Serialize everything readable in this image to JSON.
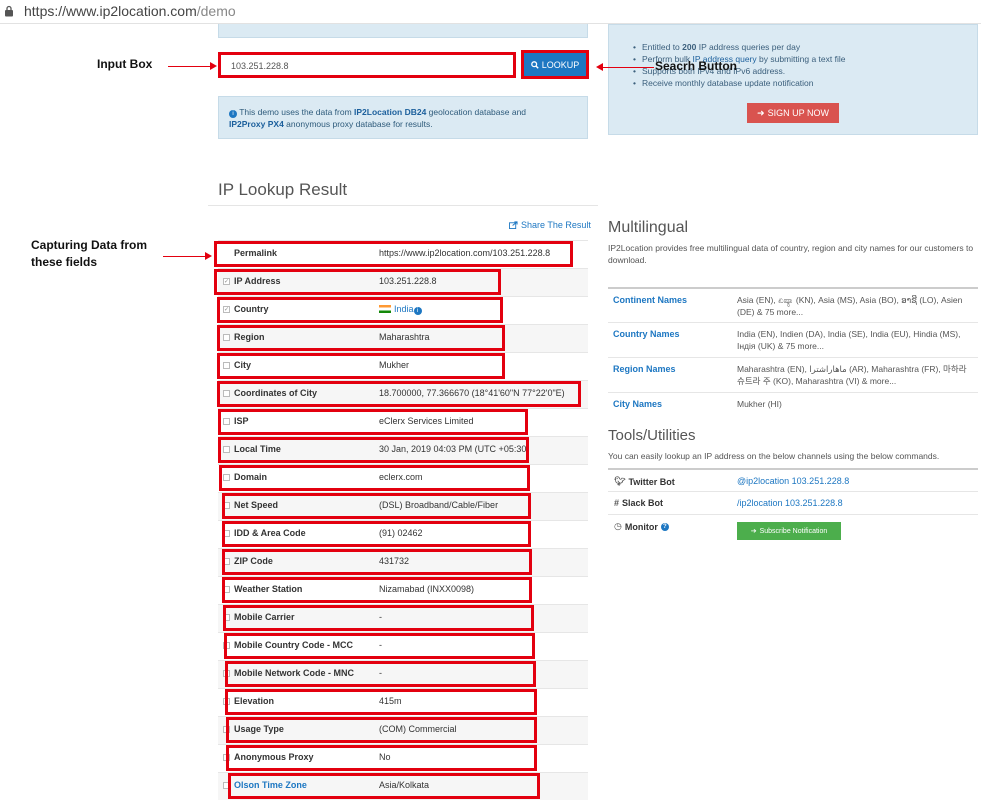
{
  "browser": {
    "url_main": "https://www.ip2location.com",
    "url_path": "/demo"
  },
  "search": {
    "input_value": "103.251.228.8",
    "lookup_label": "LOOKUP"
  },
  "annotations": {
    "input_box": "Input Box",
    "search_button": "Seacrh Button",
    "capturing_line1": "Capturing Data from",
    "capturing_line2": "these fields"
  },
  "info": {
    "prefix": "This demo uses the data from ",
    "db1": "IP2Location DB24",
    "middle": " geolocation database and",
    "db2": "IP2Proxy PX4",
    "suffix": " anonymous proxy database for results."
  },
  "promo": {
    "item1_pre": "Entitled to ",
    "item1_bold": "200",
    "item1_post": " IP address queries per day",
    "item2_pre": "Perform bulk ",
    "item2_link": "IP address query",
    "item2_post": " by submitting a text file",
    "item3": "Supports both IPv4 and IPv6 address.",
    "item4": "Receive monthly database update notification",
    "signup_label": "SIGN UP NOW"
  },
  "result": {
    "title": "IP Lookup Result",
    "share_label": "Share The Result",
    "rows": [
      {
        "label": "Permalink",
        "value": "https://www.ip2location.com/103.251.228.8"
      },
      {
        "label": "IP Address",
        "value": "103.251.228.8"
      },
      {
        "label": "Country",
        "value": "India"
      },
      {
        "label": "Region",
        "value": "Maharashtra"
      },
      {
        "label": "City",
        "value": "Mukher"
      },
      {
        "label": "Coordinates of City",
        "value": "18.700000, 77.366670 (18°41'60\"N   77°22'0\"E)"
      },
      {
        "label": "ISP",
        "value": "eClerx Services Limited"
      },
      {
        "label": "Local Time",
        "value": "30 Jan, 2019 04:03 PM (UTC +05:30)"
      },
      {
        "label": "Domain",
        "value": "eclerx.com"
      },
      {
        "label": "Net Speed",
        "value": "(DSL) Broadband/Cable/Fiber"
      },
      {
        "label": "IDD & Area Code",
        "value": "(91) 02462"
      },
      {
        "label": "ZIP Code",
        "value": "431732"
      },
      {
        "label": "Weather Station",
        "value": "Nizamabad (INXX0098)"
      },
      {
        "label": "Mobile Carrier",
        "value": "-"
      },
      {
        "label": "Mobile Country Code - MCC",
        "value": "-"
      },
      {
        "label": "Mobile Network Code - MNC",
        "value": "-"
      },
      {
        "label": "Elevation",
        "value": "415m"
      },
      {
        "label": "Usage Type",
        "value": "(COM) Commercial"
      },
      {
        "label": "Anonymous Proxy",
        "value": "No"
      },
      {
        "label": "Olson Time Zone",
        "value": "Asia/Kolkata"
      }
    ]
  },
  "multilingual": {
    "title": "Multilingual",
    "desc": "IP2Location provides free multilingual data of country, region and city names for our customers to download.",
    "rows": [
      {
        "label": "Continent Names",
        "value": "Asia (EN), ಏಷ್ಯಾ (KN), Asia (MS), Asia (BO), ອາຊີ (LO), Asien (DE) & 75 more..."
      },
      {
        "label": "Country Names",
        "value": "India (EN), Indien (DA), India (SE), India (EU), Hindia (MS), Індія (UK) & 75 more..."
      },
      {
        "label": "Region Names",
        "value": "Maharashtra (EN), ماهاراشترا (AR), Maharashtra (FR), 마하라슈트라 주 (KO), Maharashtra (VI) & more..."
      },
      {
        "label": "City Names",
        "value": "Mukher (HI)"
      }
    ]
  },
  "tools": {
    "title": "Tools/Utilities",
    "desc": "You can easily lookup an IP address on the below channels using the below commands.",
    "twitter_label": "Twitter Bot",
    "twitter_value": "@ip2location 103.251.228.8",
    "slack_label": "Slack Bot",
    "slack_value": "/ip2location 103.251.228.8",
    "monitor_label": "Monitor",
    "subscribe_label": "Subscribe Notification"
  },
  "colors": {
    "annotation_red": "#e3000f",
    "link_blue": "#1d77c2",
    "signup_red": "#d9534f",
    "subscribe_green": "#4cae4c",
    "info_bg": "#dbeaf3"
  }
}
